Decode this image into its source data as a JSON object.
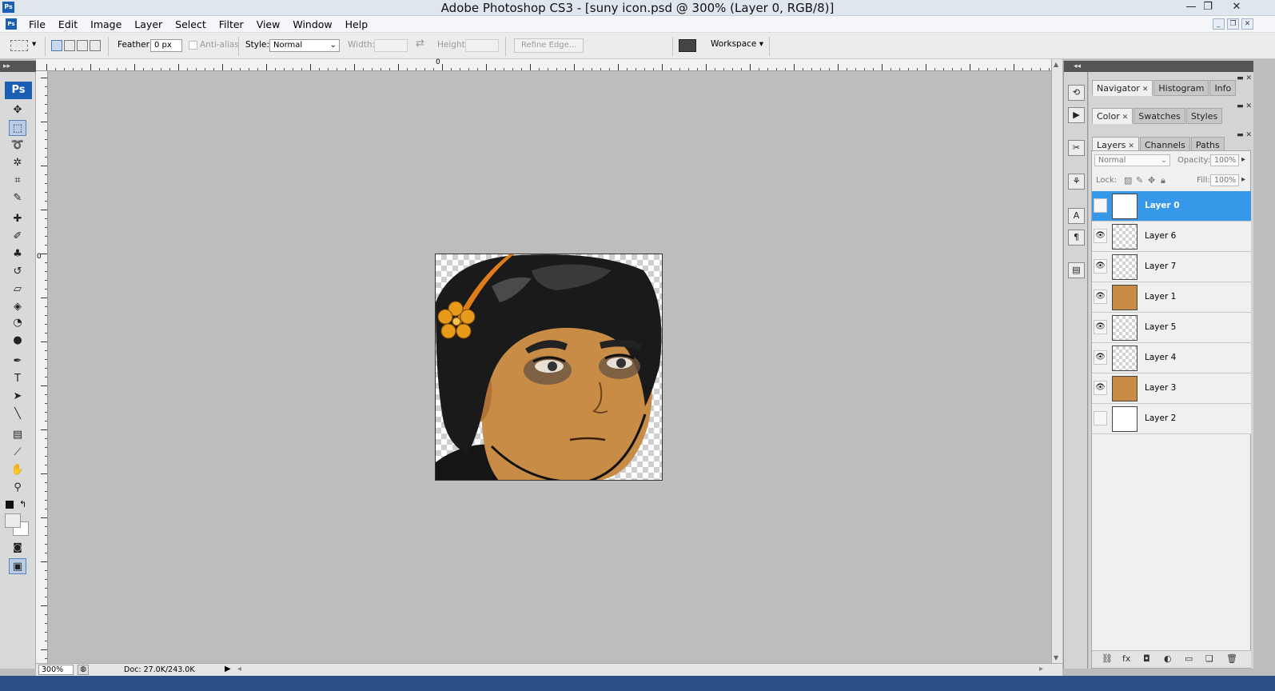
{
  "window": {
    "title": "Adobe Photoshop CS3 - [suny icon.psd @ 300% (Layer 0, RGB/8)]",
    "app_icon": "Ps",
    "minimize": "—",
    "restore": "❐",
    "close": "✕"
  },
  "menu": [
    "File",
    "Edit",
    "Image",
    "Layer",
    "Select",
    "Filter",
    "View",
    "Window",
    "Help"
  ],
  "options": {
    "feather_label": "Feather:",
    "feather_value": "0 px",
    "antialias_label": "Anti-alias",
    "style_label": "Style:",
    "style_value": "Normal",
    "width_label": "Width:",
    "height_label": "Height:",
    "refine_edge": "Refine Edge...",
    "workspace": "Workspace ▾"
  },
  "toolbar": {
    "logo": "Ps",
    "tools": [
      {
        "icon": "move-icon",
        "glyph": "✥"
      },
      {
        "icon": "marquee-icon",
        "glyph": "⬚",
        "active": true
      },
      {
        "icon": "lasso-icon",
        "glyph": "➰"
      },
      {
        "icon": "magic-wand-icon",
        "glyph": "✲"
      },
      {
        "icon": "crop-icon",
        "glyph": "⌗"
      },
      {
        "icon": "slice-icon",
        "glyph": "✎"
      },
      {
        "icon": "healing-brush-icon",
        "glyph": "✚"
      },
      {
        "icon": "brush-icon",
        "glyph": "✐"
      },
      {
        "icon": "clone-stamp-icon",
        "glyph": "♣"
      },
      {
        "icon": "history-brush-icon",
        "glyph": "↺"
      },
      {
        "icon": "eraser-icon",
        "glyph": "▱"
      },
      {
        "icon": "paint-bucket-icon",
        "glyph": "◈"
      },
      {
        "icon": "blur-icon",
        "glyph": "◔"
      },
      {
        "icon": "dodge-icon",
        "glyph": "●"
      },
      {
        "icon": "pen-icon",
        "glyph": "✒"
      },
      {
        "icon": "type-icon",
        "glyph": "T"
      },
      {
        "icon": "path-selection-icon",
        "glyph": "➤"
      },
      {
        "icon": "line-icon",
        "glyph": "╲"
      },
      {
        "icon": "notes-icon",
        "glyph": "▤"
      },
      {
        "icon": "eyedropper-icon",
        "glyph": "⟋"
      },
      {
        "icon": "hand-icon",
        "glyph": "✋"
      },
      {
        "icon": "zoom-icon",
        "glyph": "⚲"
      }
    ]
  },
  "rulers": {
    "top_zero": "0",
    "left_zero": "0"
  },
  "status": {
    "zoom": "300%",
    "doc": "Doc: 27.0K/243.0K"
  },
  "panels": {
    "group1": {
      "tabs": [
        "Navigator",
        "Histogram",
        "Info"
      ]
    },
    "group2": {
      "tabs": [
        "Color",
        "Swatches",
        "Styles"
      ]
    },
    "group3": {
      "tabs": [
        "Layers",
        "Channels",
        "Paths"
      ]
    },
    "layers": {
      "blend_mode": "Normal",
      "opacity_label": "Opacity:",
      "opacity_value": "100%",
      "lock_label": "Lock:",
      "fill_label": "Fill:",
      "fill_value": "100%",
      "items": [
        {
          "name": "Layer 0",
          "visible": false,
          "selected": true,
          "thumb": "plain"
        },
        {
          "name": "Layer 6",
          "visible": true,
          "selected": false,
          "thumb": "checker"
        },
        {
          "name": "Layer 7",
          "visible": true,
          "selected": false,
          "thumb": "checker"
        },
        {
          "name": "Layer 1",
          "visible": true,
          "selected": false,
          "thumb": "face"
        },
        {
          "name": "Layer 5",
          "visible": true,
          "selected": false,
          "thumb": "checker"
        },
        {
          "name": "Layer 4",
          "visible": true,
          "selected": false,
          "thumb": "checker"
        },
        {
          "name": "Layer 3",
          "visible": true,
          "selected": false,
          "thumb": "face"
        },
        {
          "name": "Layer 2",
          "visible": false,
          "selected": false,
          "thumb": "plain"
        }
      ]
    }
  },
  "colors": {
    "selection_blue": "#3598e8",
    "canvas_bg": "#bdbdbd",
    "skin": "#c98c46",
    "flower": "#e89a1a"
  }
}
